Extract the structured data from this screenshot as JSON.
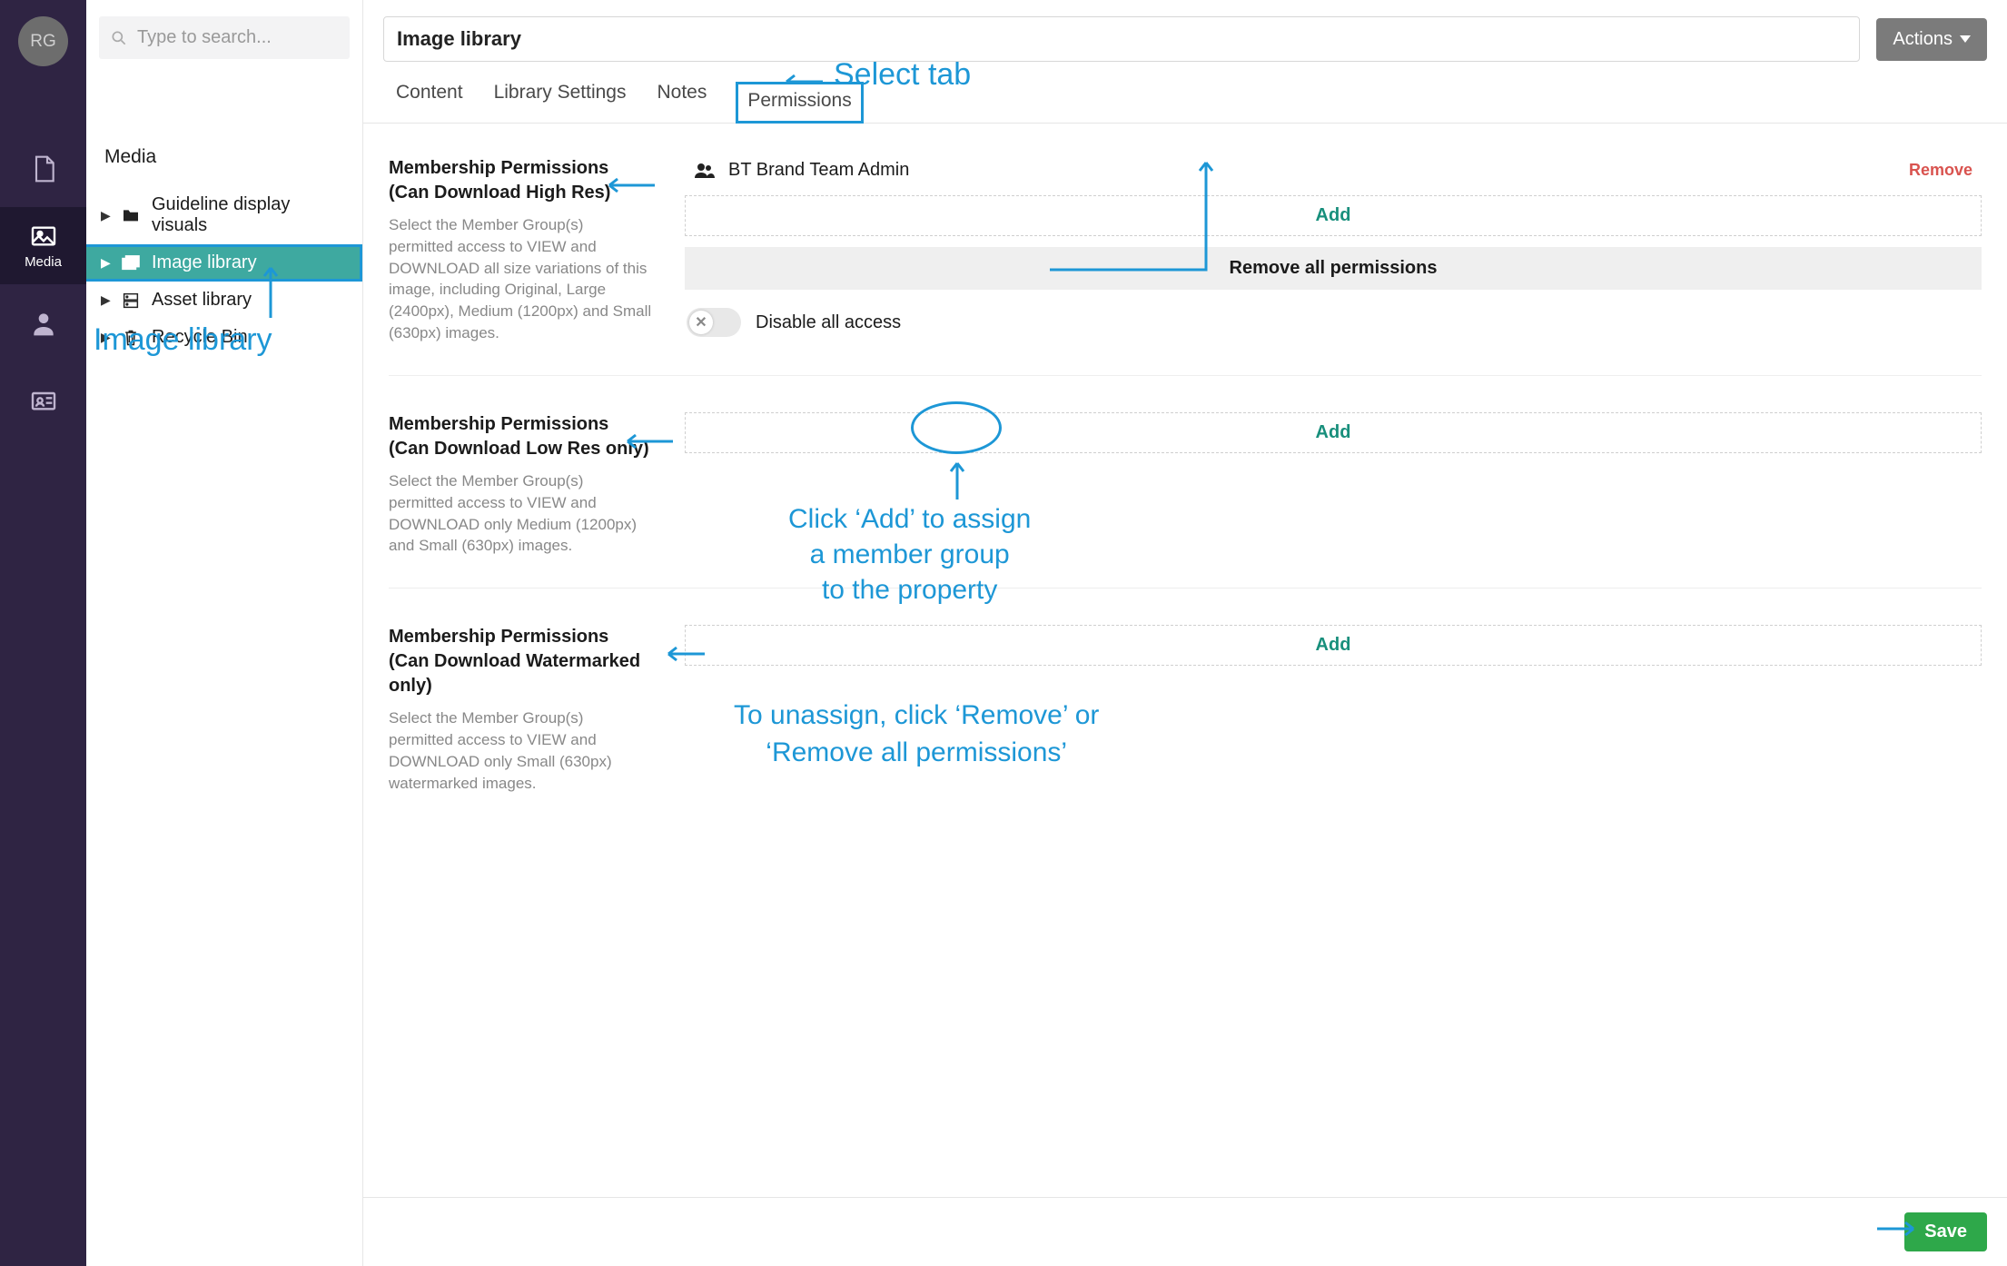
{
  "avatar_initials": "RG",
  "nav": {
    "items": [
      {
        "name": "content-icon",
        "label": ""
      },
      {
        "name": "media-icon",
        "label": "Media"
      },
      {
        "name": "members-icon",
        "label": ""
      },
      {
        "name": "card-icon",
        "label": ""
      }
    ]
  },
  "search": {
    "placeholder": "Type to search..."
  },
  "sidebar": {
    "title": "Media",
    "items": [
      {
        "label": "Guideline display visuals",
        "icon": "folder"
      },
      {
        "label": "Image library",
        "icon": "images",
        "selected": true
      },
      {
        "label": "Asset library",
        "icon": "drive"
      },
      {
        "label": "Recycle Bin",
        "icon": "trash"
      }
    ]
  },
  "header": {
    "title": "Image library",
    "actions_label": "Actions"
  },
  "tabs": [
    {
      "label": "Content"
    },
    {
      "label": "Library Settings"
    },
    {
      "label": "Notes"
    },
    {
      "label": "Permissions",
      "active": true
    }
  ],
  "blocks": [
    {
      "title": "Membership Permissions (Can Download High Res)",
      "desc": "Select the Member Group(s) permitted access to VIEW and DOWNLOAD all size variations of this image, including Original, Large (2400px), Medium (1200px) and Small (630px) images.",
      "members": [
        {
          "name": "BT Brand Team Admin"
        }
      ],
      "add_label": "Add",
      "remove_label": "Remove",
      "remove_all_label": "Remove all permissions",
      "disable_label": "Disable all access"
    },
    {
      "title": "Membership Permissions (Can Download Low Res only)",
      "desc": "Select the Member Group(s) permitted access to VIEW and DOWNLOAD only Medium (1200px) and Small (630px) images.",
      "add_label": "Add"
    },
    {
      "title": "Membership Permissions (Can Download Watermarked only)",
      "desc": "Select the Member Group(s) permitted access to VIEW and DOWNLOAD only Small (630px) watermarked images.",
      "add_label": "Add"
    }
  ],
  "footer": {
    "save_label": "Save"
  },
  "annotations": {
    "select_tab": "Select tab",
    "image_library": "Image library",
    "click_add": "Click ‘Add’ to assign\na member group\nto the property",
    "unassign": "To unassign, click ‘Remove’ or\n‘Remove all permissions’"
  }
}
